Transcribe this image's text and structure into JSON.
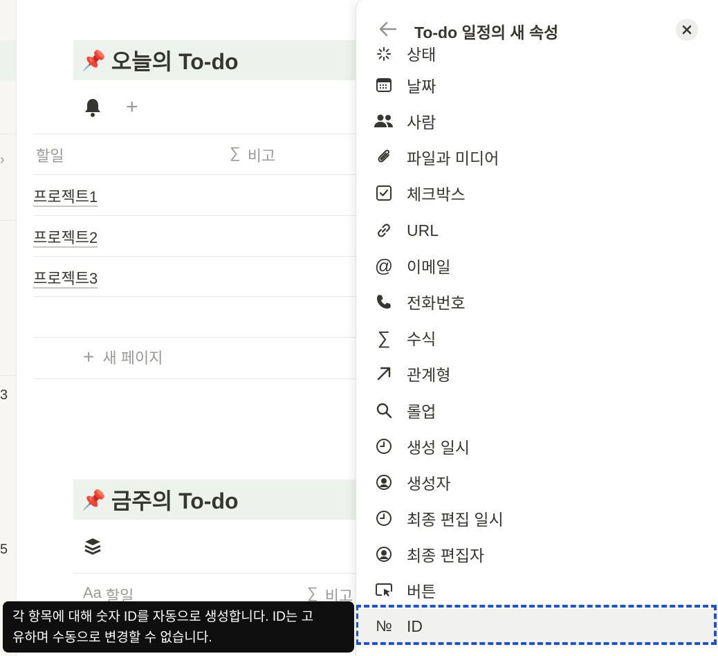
{
  "background": {
    "sidebar_numbers": [
      "3",
      "5"
    ],
    "section1": {
      "pin_icon": "pushpin-icon",
      "title": "오늘의 To-do",
      "col_task": "할일",
      "col_note": "비고",
      "rows": [
        "프로젝트1",
        "프로젝트2",
        "프로젝트3"
      ],
      "new_page": "새 페이지"
    },
    "section2": {
      "pin_icon": "pushpin-icon",
      "title": "금주의 To-do",
      "col_task_prefix": "Aa",
      "col_task": "할일",
      "col_note": "비고"
    }
  },
  "panel": {
    "title": "To-do 일정의 새 속성",
    "items": [
      {
        "label": "상태",
        "icon": "status-icon"
      },
      {
        "label": "날짜",
        "icon": "calendar-icon"
      },
      {
        "label": "사람",
        "icon": "people-icon"
      },
      {
        "label": "파일과 미디어",
        "icon": "paperclip-icon"
      },
      {
        "label": "체크박스",
        "icon": "checkbox-icon"
      },
      {
        "label": "URL",
        "icon": "link-icon"
      },
      {
        "label": "이메일",
        "icon": "at-icon"
      },
      {
        "label": "전화번호",
        "icon": "phone-icon"
      },
      {
        "label": "수식",
        "icon": "sigma-icon"
      },
      {
        "label": "관계형",
        "icon": "arrow-up-right-icon"
      },
      {
        "label": "롤업",
        "icon": "search-icon"
      },
      {
        "label": "생성 일시",
        "icon": "clock-icon"
      },
      {
        "label": "생성자",
        "icon": "user-circle-icon"
      },
      {
        "label": "최종 편집 일시",
        "icon": "clock-icon"
      },
      {
        "label": "최종 편집자",
        "icon": "user-circle-icon"
      },
      {
        "label": "버튼",
        "icon": "cursor-button-icon"
      },
      {
        "label": "ID",
        "icon": "number-sign-icon",
        "glyph": "№"
      }
    ]
  },
  "tooltip": {
    "line1": "각 항목에 대해 숫자 ID를 자동으로 생성합니다. ID는 고",
    "line2": "유하며 수동으로 변경할 수 없습니다."
  },
  "colors": {
    "header_bg": "#edf3ec",
    "selection_outline": "#1f52d0",
    "tooltip_bg": "#0f0f0f"
  }
}
